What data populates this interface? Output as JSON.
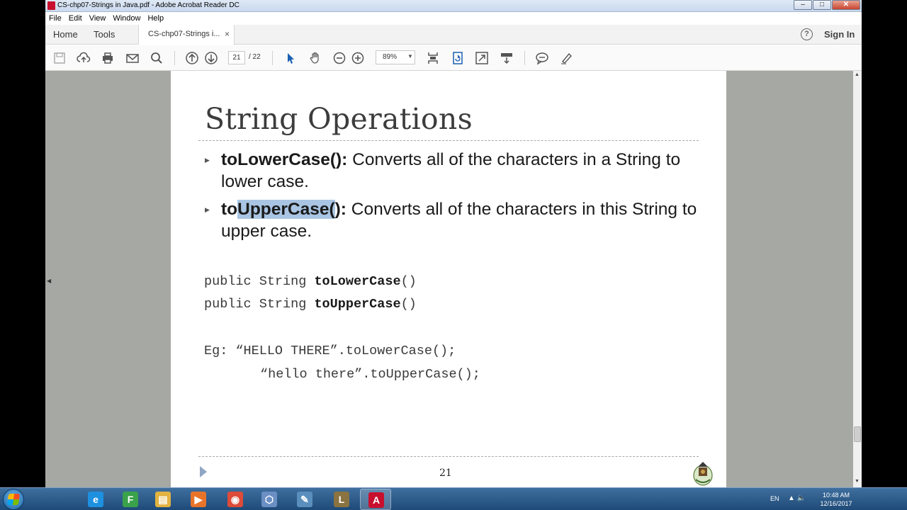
{
  "window": {
    "title": "CS-chp07-Strings in Java.pdf - Adobe Acrobat Reader DC",
    "buttons": {
      "minimize": "–",
      "maximize": "□",
      "close": "✕"
    }
  },
  "menu": {
    "items": [
      {
        "label": "File"
      },
      {
        "label": "Edit"
      },
      {
        "label": "View"
      },
      {
        "label": "Window"
      },
      {
        "label": "Help"
      }
    ]
  },
  "tabs": {
    "home": "Home",
    "tools": "Tools",
    "document": "CS-chp07-Strings i...",
    "document_close": "×",
    "help_icon": "?",
    "sign_in": "Sign In"
  },
  "toolbar": {
    "icons": [
      "save-icon",
      "upload-icon",
      "print-icon",
      "email-icon",
      "search-icon",
      "prev-page-icon",
      "next-page-icon",
      "select-icon",
      "hand-icon",
      "zoom-out-icon",
      "zoom-in-icon",
      "fit-page-icon",
      "rotate-icon",
      "fullscreen-icon",
      "scroll-mode-icon",
      "comment-icon",
      "highlight-icon"
    ],
    "page_current": "21",
    "page_total": "/ 22",
    "zoom": "89%"
  },
  "slide": {
    "title": "String Operations",
    "bullets": [
      {
        "term": "toLowerCase():",
        "text": " Converts all of the characters in a String to lower case."
      },
      {
        "term_prefix": "to",
        "term_highlight": "UpperCase(",
        "term_suffix": "):",
        "text": " Converts all of the characters in this String to upper case."
      }
    ],
    "code": {
      "sig1_prefix": "public String ",
      "sig1_method": "toLowerCase",
      "sig1_suffix": "()",
      "sig2_prefix": "public String ",
      "sig2_method": "toUpperCase",
      "sig2_suffix": "()",
      "eg1": "Eg: “HELLO THERE”.toLowerCase();",
      "eg2": "“hello there”.toUpperCase();"
    },
    "page_number": "21"
  },
  "taskbar": {
    "apps": [
      {
        "name": "internet-explorer-icon",
        "glyph": "e",
        "color": "#1e90e0"
      },
      {
        "name": "f-app-icon",
        "glyph": "F",
        "color": "#3aa24a"
      },
      {
        "name": "file-explorer-icon",
        "glyph": "▤",
        "color": "#e3b341"
      },
      {
        "name": "media-player-icon",
        "glyph": "▶",
        "color": "#e8742a"
      },
      {
        "name": "chrome-icon",
        "glyph": "◉",
        "color": "#dd4b39"
      },
      {
        "name": "virtualbox-icon",
        "glyph": "⬡",
        "color": "#6b8fc4"
      },
      {
        "name": "tool-app-icon",
        "glyph": "✎",
        "color": "#5a8fbd"
      },
      {
        "name": "league-of-legends-icon",
        "glyph": "L",
        "color": "#8a7340"
      },
      {
        "name": "acrobat-reader-icon",
        "glyph": "A",
        "color": "#c8102e"
      }
    ],
    "lang": "EN",
    "tray": "▲  🔈",
    "time": "10:48 AM",
    "date": "12/16/2017"
  }
}
